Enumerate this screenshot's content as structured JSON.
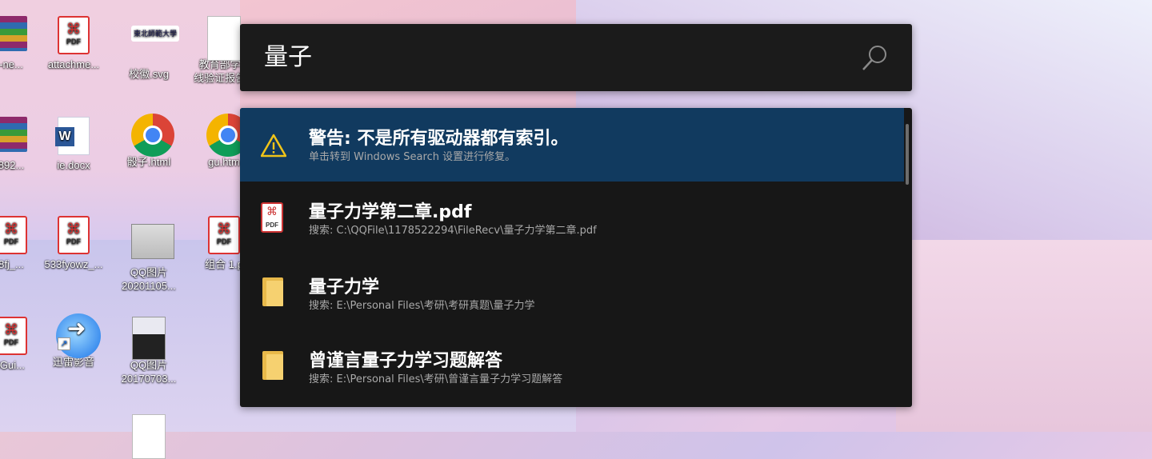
{
  "desktop": {
    "icons": [
      {
        "label": "-ne...",
        "kind": "rar"
      },
      {
        "label": "attachme...",
        "kind": "pdf"
      },
      {
        "label": "校徽.svg",
        "kind": "svg"
      },
      {
        "label": "教育部学...",
        "label2": "线验证报告...",
        "kind": "doc"
      },
      {
        "label": "892...",
        "kind": "rar"
      },
      {
        "label": "ie.docx",
        "kind": "word"
      },
      {
        "label": "骰子.html",
        "kind": "chrome"
      },
      {
        "label": "gu.htm",
        "kind": "chrome"
      },
      {
        "label": "8fj_...",
        "kind": "pdf"
      },
      {
        "label": "533fyowz_...",
        "kind": "pdf"
      },
      {
        "label": "QQ图片",
        "label2": "20201105...",
        "kind": "photo"
      },
      {
        "label": "组合 1.p",
        "kind": "pdf"
      },
      {
        "label": "lGui...",
        "kind": "pdf"
      },
      {
        "label": "迅雷影音",
        "kind": "thunder"
      },
      {
        "label": "QQ图片",
        "label2": "20170703...",
        "kind": "portrait"
      }
    ],
    "pdf_tag": "PDF",
    "word_tag": "W",
    "seal_text": "東北師範大學"
  },
  "search": {
    "query": "量子",
    "icon": "magnifier-icon"
  },
  "results": [
    {
      "icon": "warning-icon",
      "title": "警告: 不是所有驱动器都有索引。",
      "subtitle": "单击转到 Windows Search 设置进行修复。",
      "selected": true
    },
    {
      "icon": "pdf-icon",
      "title": "量子力学第二章.pdf",
      "subtitle": "搜索: C:\\QQFile\\1178522294\\FileRecv\\量子力学第二章.pdf",
      "selected": false
    },
    {
      "icon": "folder-icon",
      "title": "量子力学",
      "subtitle": "搜索: E:\\Personal Files\\考研\\考研真题\\量子力学",
      "selected": false
    },
    {
      "icon": "folder-icon",
      "title": "曾谨言量子力学习题解答",
      "subtitle": "搜索: E:\\Personal Files\\考研\\曾谨言量子力学习题解答",
      "selected": false
    }
  ],
  "colors": {
    "selected_row": "#113a5f",
    "panel_bg": "#171717",
    "warning": "#f0c419"
  }
}
